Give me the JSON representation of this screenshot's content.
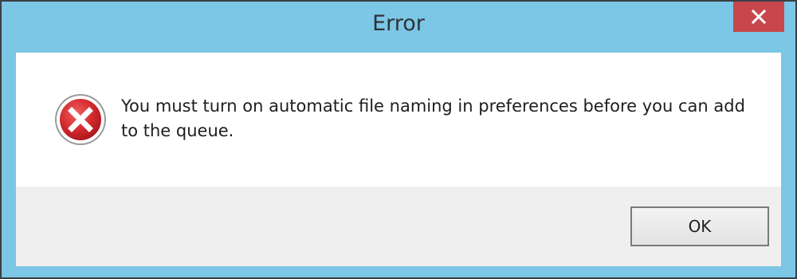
{
  "window": {
    "title": "Error",
    "close_icon": "close-icon"
  },
  "dialog": {
    "icon": "error-icon",
    "message": "You must turn on automatic file naming in preferences before you can add to the queue.",
    "ok_label": "OK"
  },
  "colors": {
    "titlebar": "#7cc6e6",
    "close_button": "#c7474c",
    "error_icon": "#c8262b",
    "footer": "#efefef"
  }
}
